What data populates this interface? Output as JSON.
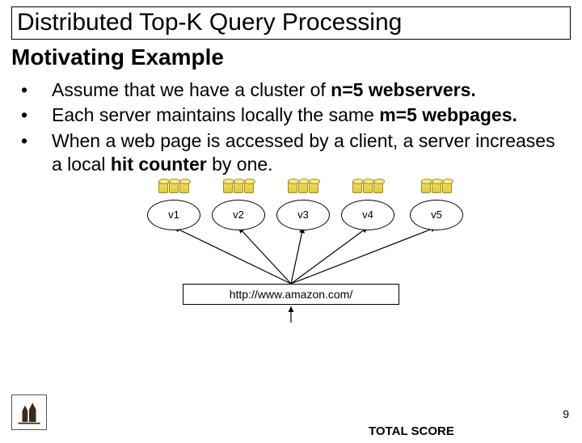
{
  "title": "Distributed Top-K Query Processing",
  "subtitle": "Motivating Example",
  "bullets": [
    {
      "pre": "Assume that we have a cluster of ",
      "bold": "n=5 webservers."
    },
    {
      "pre": "Each server maintains locally the same ",
      "bold": "m=5 webpages."
    },
    {
      "pre": "When a web page is accessed by a client, a server increases a local ",
      "bold": "hit counter",
      "post": " by one."
    }
  ],
  "servers": [
    "v1",
    "v2",
    "v3",
    "v4",
    "v5"
  ],
  "url": "http://www.amazon.com/",
  "page_number": "9",
  "total_score_label": "TOTAL SCORE"
}
